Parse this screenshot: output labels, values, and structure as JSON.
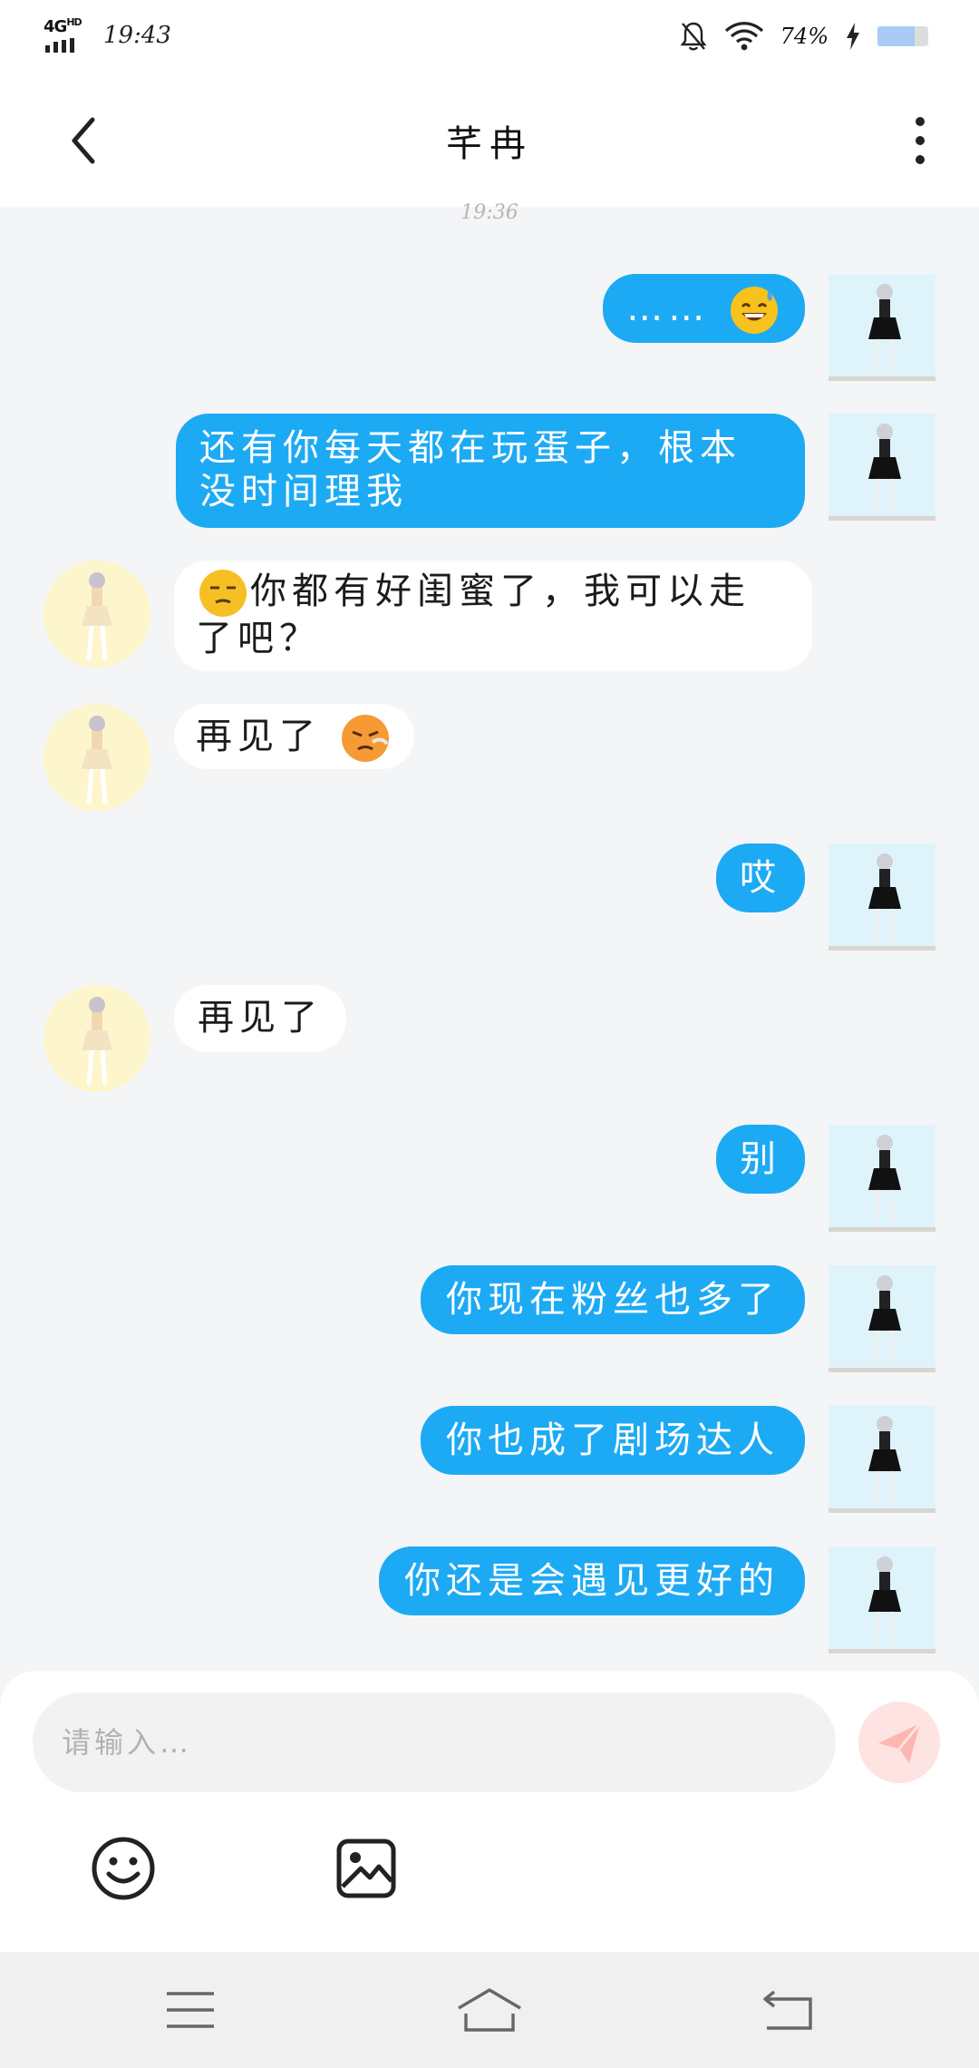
{
  "status_bar": {
    "network": "4G",
    "network_sup": "HD",
    "time": "19:43",
    "battery_percent": "74%",
    "battery_level": 0.74
  },
  "header": {
    "title": "芊冉",
    "back_icon": "chevron-left-icon",
    "more_icon": "more-vertical-icon"
  },
  "chat": {
    "timestamp": "19:36",
    "messages": [
      {
        "side": "self",
        "text": "……"
      },
      {
        "side": "self",
        "text": "还有你每天都在玩蛋子，根本没时间理我"
      },
      {
        "side": "other",
        "text": "你都有好闺蜜了，我可以走了吧？"
      },
      {
        "side": "other",
        "text": "再见了"
      },
      {
        "side": "self",
        "text": "哎"
      },
      {
        "side": "other",
        "text": "再见了"
      },
      {
        "side": "self",
        "text": "别"
      },
      {
        "side": "self",
        "text": "你现在粉丝也多了"
      },
      {
        "side": "self",
        "text": "你也成了剧场达人"
      },
      {
        "side": "self",
        "text": "你还是会遇见更好的"
      }
    ]
  },
  "composer": {
    "placeholder": "请输入…",
    "send_icon": "send-icon",
    "emoji_icon": "emoji-icon",
    "image_icon": "image-icon"
  },
  "nav_bar": {
    "menu_icon": "menu-icon",
    "home_icon": "home-icon",
    "back_icon": "back-icon"
  },
  "colors": {
    "self_bubble": "#1daaf4",
    "other_bubble": "#ffffff",
    "background": "#f4f5f7",
    "send_button": "#fde3e1"
  }
}
